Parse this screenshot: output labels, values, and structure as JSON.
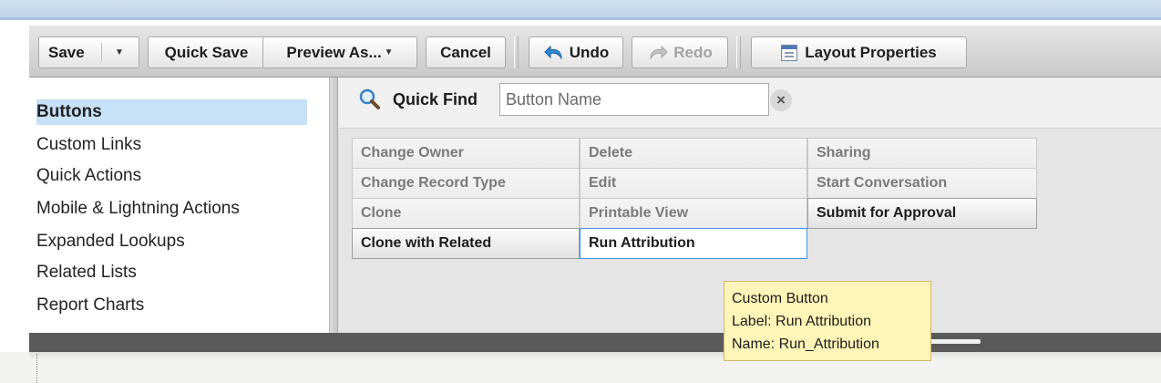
{
  "toolbar": {
    "save_label": "Save",
    "quick_save_label": "Quick Save",
    "preview_as_label": "Preview As...",
    "cancel_label": "Cancel",
    "undo_label": "Undo",
    "redo_label": "Redo",
    "layout_properties_label": "Layout Properties"
  },
  "sidebar": {
    "items": [
      {
        "label": "Buttons",
        "selected": true
      },
      {
        "label": "Custom Links"
      },
      {
        "label": "Quick Actions"
      },
      {
        "label": "Mobile & Lightning Actions"
      },
      {
        "label": "Expanded Lookups"
      },
      {
        "label": "Related Lists"
      },
      {
        "label": "Report Charts"
      }
    ]
  },
  "quick_find": {
    "label": "Quick Find",
    "placeholder": "Button Name",
    "value": ""
  },
  "buttons_grid": {
    "rows": [
      [
        "Change Owner",
        "Delete",
        "Sharing"
      ],
      [
        "Change Record Type",
        "Edit",
        "Start Conversation"
      ],
      [
        "Clone",
        "Printable View",
        "Submit for Approval"
      ],
      [
        "Clone with Related",
        "Run Attribution"
      ]
    ]
  },
  "tooltip": {
    "line1": "Custom Button",
    "line2": "Label: Run Attribution",
    "line3": "Name: Run_Attribution"
  },
  "colors": {
    "accent_selected_bg": "#c7e1f6",
    "selected_border": "#3e8ee8",
    "tooltip_bg": "#fff5b8"
  },
  "icons": {
    "undo": "undo-icon",
    "redo": "redo-icon",
    "layout": "layout-icon",
    "search": "search-icon",
    "clear": "clear-icon"
  }
}
